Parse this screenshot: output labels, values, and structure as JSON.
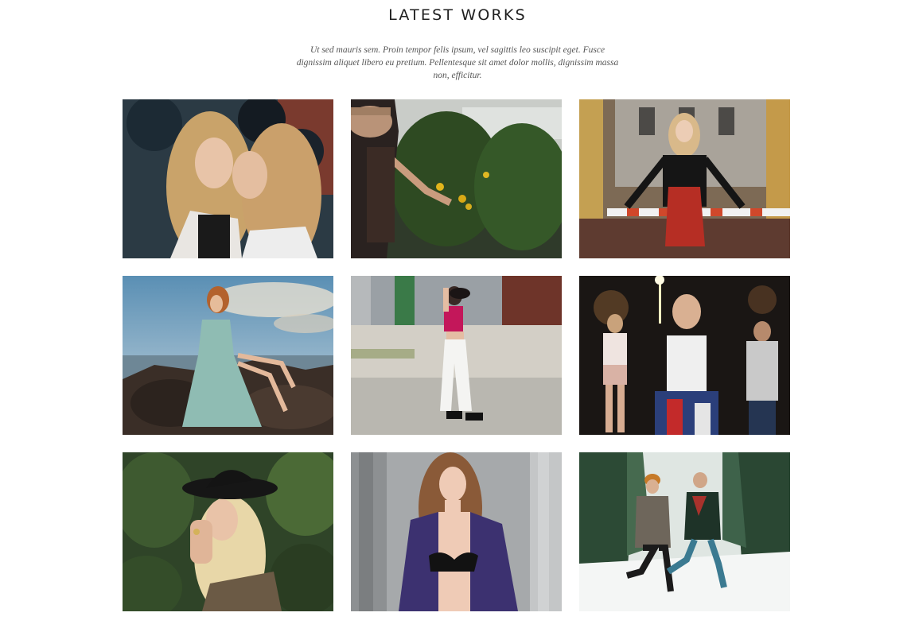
{
  "section": {
    "title": "LATEST WORKS",
    "description": "Ut sed mauris sem. Proin tempor felis ipsum, vel sagittis leo suscipit eget. Fusce dignissim aliquet libero eu pretium. Pellentesque sit amet dolor mollis, dignissim massa non, efficitur."
  },
  "gallery": {
    "items": [
      {
        "scene": "two-women-hugging-balloons"
      },
      {
        "scene": "woman-picking-lemons-garden"
      },
      {
        "scene": "woman-leather-jacket-street-barrier"
      },
      {
        "scene": "woman-blue-dress-rocks-sky"
      },
      {
        "scene": "woman-pink-top-concrete-wall"
      },
      {
        "scene": "friends-night-sparkler"
      },
      {
        "scene": "blonde-woman-black-hat-leaves"
      },
      {
        "scene": "woman-purple-jacket-columns"
      },
      {
        "scene": "couple-jumping-snowy-forest"
      }
    ]
  }
}
